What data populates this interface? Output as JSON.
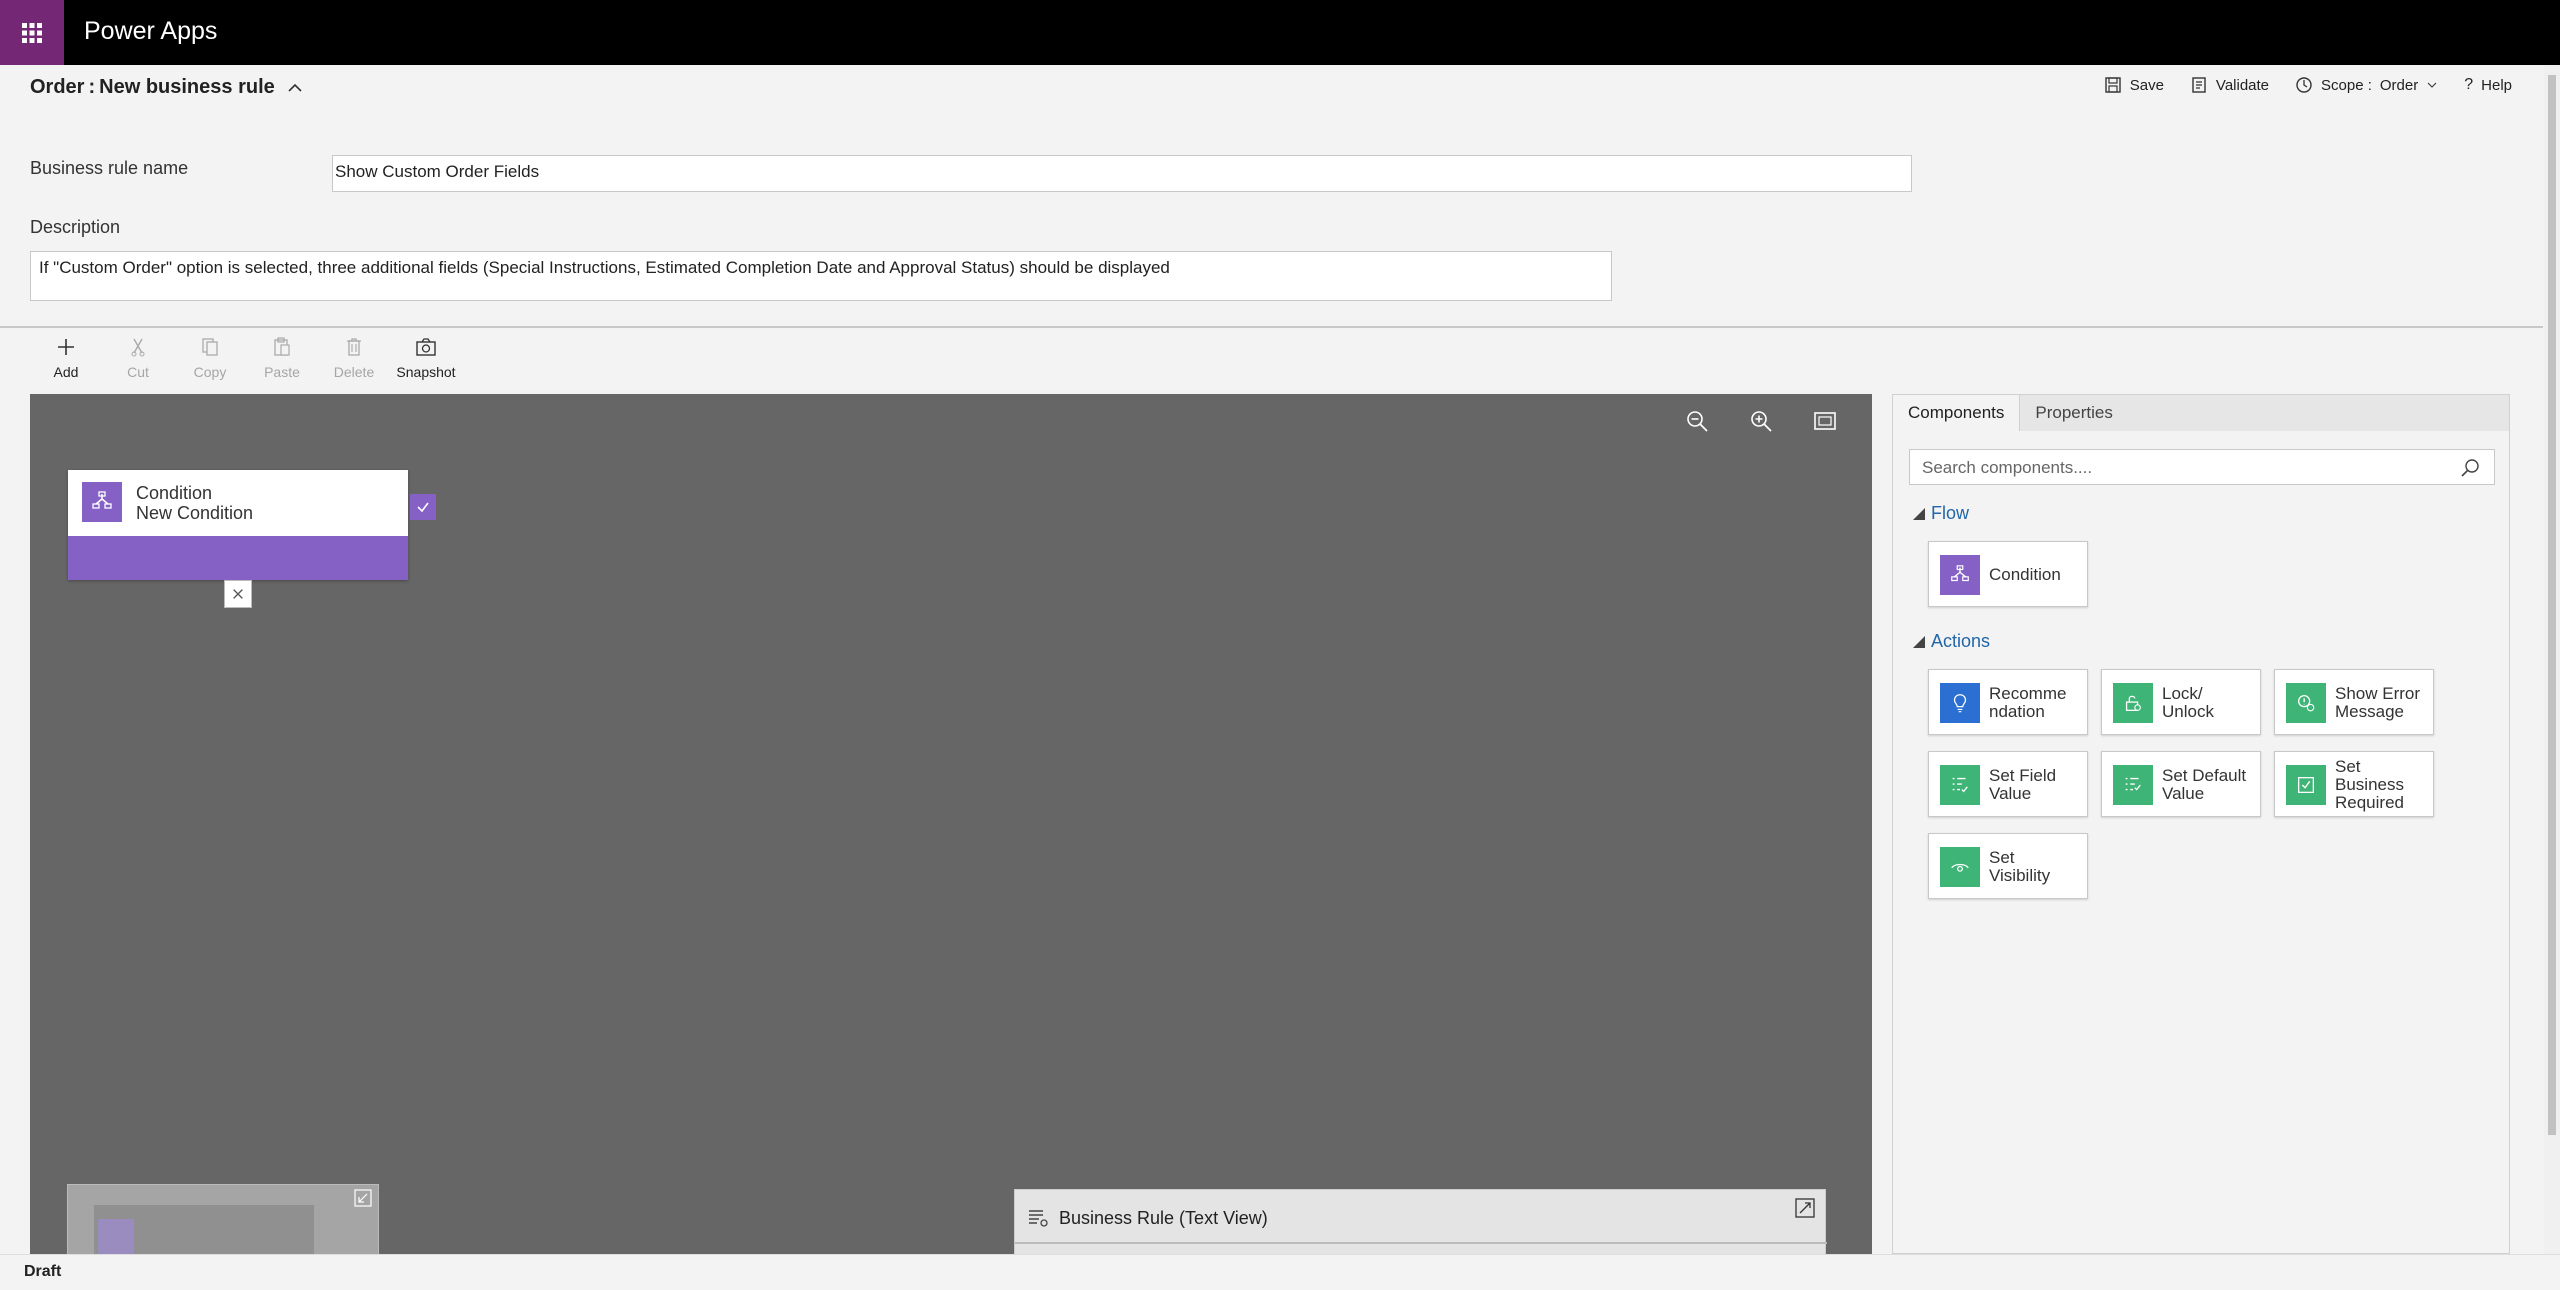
{
  "app": {
    "title": "Power Apps"
  },
  "header": {
    "entity": "Order",
    "separator": ":",
    "rule_title": "New business rule",
    "commands": {
      "save": "Save",
      "validate": "Validate",
      "scope_label": "Scope :",
      "scope_value": "Order",
      "help": "Help"
    }
  },
  "form": {
    "name_label": "Business rule name",
    "name_value": "Show Custom Order Fields",
    "description_label": "Description",
    "description_value": "If \"Custom Order\" option is selected, three additional fields (Special Instructions, Estimated Completion Date and Approval Status) should be displayed"
  },
  "toolbar": {
    "add": "Add",
    "cut": "Cut",
    "copy": "Copy",
    "paste": "Paste",
    "delete": "Delete",
    "snapshot": "Snapshot"
  },
  "canvas": {
    "condition_node": {
      "type": "Condition",
      "name": "New Condition"
    },
    "text_view_title": "Business Rule (Text View)"
  },
  "panel": {
    "tabs": [
      "Components",
      "Properties"
    ],
    "search_placeholder": "Search components....",
    "flow_section": "Flow",
    "flow_items": [
      "Condition"
    ],
    "actions_section": "Actions",
    "action_items": [
      "Recomme\nndation",
      "Lock/\nUnlock",
      "Show Error\nMessage",
      "Set Field\nValue",
      "Set Default\nValue",
      "Set\nBusiness\nRequired",
      "Set\nVisibility"
    ]
  },
  "status": {
    "text": "Draft"
  },
  "colors": {
    "accent": "#742774",
    "condition": "#8661c5",
    "recommendation": "#2b6fd2",
    "action": "#3fb477"
  }
}
